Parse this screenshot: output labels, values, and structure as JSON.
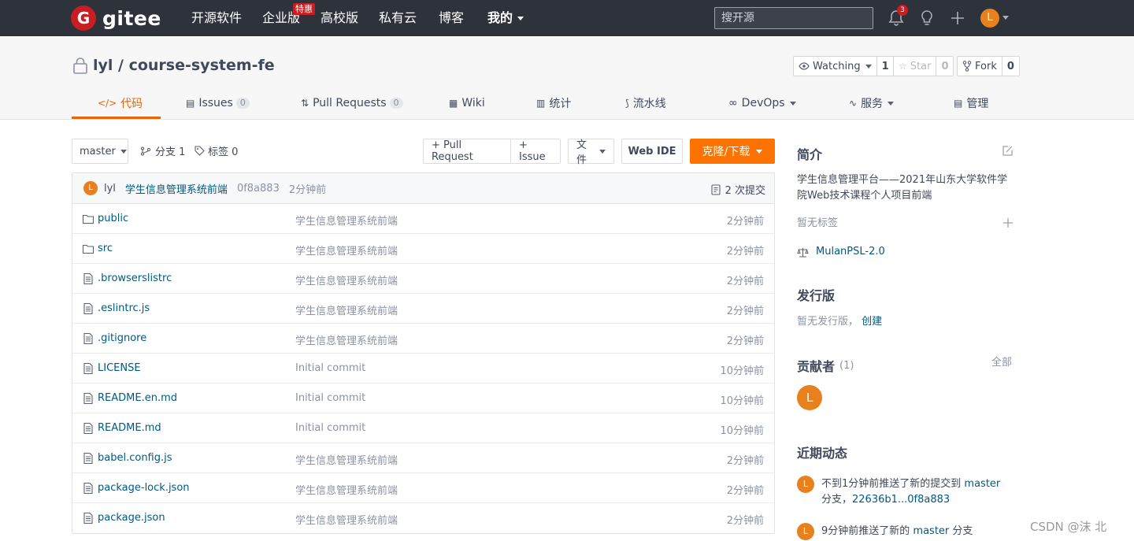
{
  "topnav": {
    "logo_mark": "G",
    "logo_text": "gitee",
    "items": [
      "开源软件",
      "企业版",
      "高校版",
      "私有云",
      "博客",
      "我的"
    ],
    "enterprise_badge": "特惠",
    "search_placeholder": "搜开源",
    "notification_count": "3",
    "user_initial": "L"
  },
  "repo": {
    "title": "lyl / course-system-fe",
    "watching_label": "Watching",
    "watching_count": "1",
    "star_label": "Star",
    "star_count": "0",
    "fork_label": "Fork",
    "fork_count": "0"
  },
  "tabs": [
    {
      "label": "代码",
      "icon": "code-icon"
    },
    {
      "label": "Issues",
      "icon": "issues-icon",
      "count": "0"
    },
    {
      "label": "Pull Requests",
      "icon": "pull-request-icon",
      "count": "0"
    },
    {
      "label": "Wiki",
      "icon": "wiki-icon"
    },
    {
      "label": "统计",
      "icon": "stats-icon"
    },
    {
      "label": "流水线",
      "icon": "pipeline-icon"
    },
    {
      "label": "DevOps",
      "icon": "devops-icon"
    },
    {
      "label": "服务",
      "icon": "service-icon"
    },
    {
      "label": "管理",
      "icon": "manage-icon"
    }
  ],
  "toolbar": {
    "branch": "master",
    "branches": "分支 1",
    "tags": "标签 0",
    "pull_request": "+ Pull Request",
    "issue": "+ Issue",
    "file": "文件",
    "web_ide": "Web IDE",
    "clone": "克隆/下载"
  },
  "commit": {
    "avatar": "L",
    "author": "lyl",
    "message": "学生信息管理系统前端",
    "hash": "0f8a883",
    "time": "2分钟前",
    "count": "2 次提交"
  },
  "files": [
    {
      "name": "public",
      "type": "folder",
      "message": "学生信息管理系统前端",
      "time": "2分钟前"
    },
    {
      "name": "src",
      "type": "folder",
      "message": "学生信息管理系统前端",
      "time": "2分钟前"
    },
    {
      "name": ".browserslistrc",
      "type": "file",
      "message": "学生信息管理系统前端",
      "time": "2分钟前"
    },
    {
      "name": ".eslintrc.js",
      "type": "file",
      "message": "学生信息管理系统前端",
      "time": "2分钟前"
    },
    {
      "name": ".gitignore",
      "type": "file",
      "message": "学生信息管理系统前端",
      "time": "2分钟前"
    },
    {
      "name": "LICENSE",
      "type": "file",
      "message": "Initial commit",
      "time": "10分钟前"
    },
    {
      "name": "README.en.md",
      "type": "file",
      "message": "Initial commit",
      "time": "10分钟前"
    },
    {
      "name": "README.md",
      "type": "file",
      "message": "Initial commit",
      "time": "10分钟前"
    },
    {
      "name": "babel.config.js",
      "type": "file",
      "message": "学生信息管理系统前端",
      "time": "2分钟前"
    },
    {
      "name": "package-lock.json",
      "type": "file",
      "message": "学生信息管理系统前端",
      "time": "2分钟前"
    },
    {
      "name": "package.json",
      "type": "file",
      "message": "学生信息管理系统前端",
      "time": "2分钟前"
    }
  ],
  "sidebar": {
    "intro_title": "简介",
    "intro_text": "学生信息管理平台——2021年山东大学软件学院Web技术课程个人项目前端",
    "no_tags": "暂无标签",
    "license": "MulanPSL-2.0",
    "releases_title": "发行版",
    "no_releases": "暂无发行版，",
    "create": "创建",
    "contributors_title": "贡献者",
    "contributors_count": "(1)",
    "all": "全部",
    "contributor_initial": "L",
    "activity_title": "近期动态",
    "activities": [
      {
        "avatar": "L",
        "text1": "不到1分钟前推送了新的提交到",
        "link1": "master",
        "text2": "分支，",
        "link2": "22636b1...0f8a883"
      },
      {
        "avatar": "L",
        "text1": "9分钟前推送了新的",
        "link1": "master",
        "text2": "分支"
      }
    ]
  },
  "watermark": "CSDN @沫 北",
  "colors": {
    "accent": "#fe7300",
    "nav_bg": "#2e323b",
    "link": "#005980",
    "brand": "#c71d23"
  }
}
